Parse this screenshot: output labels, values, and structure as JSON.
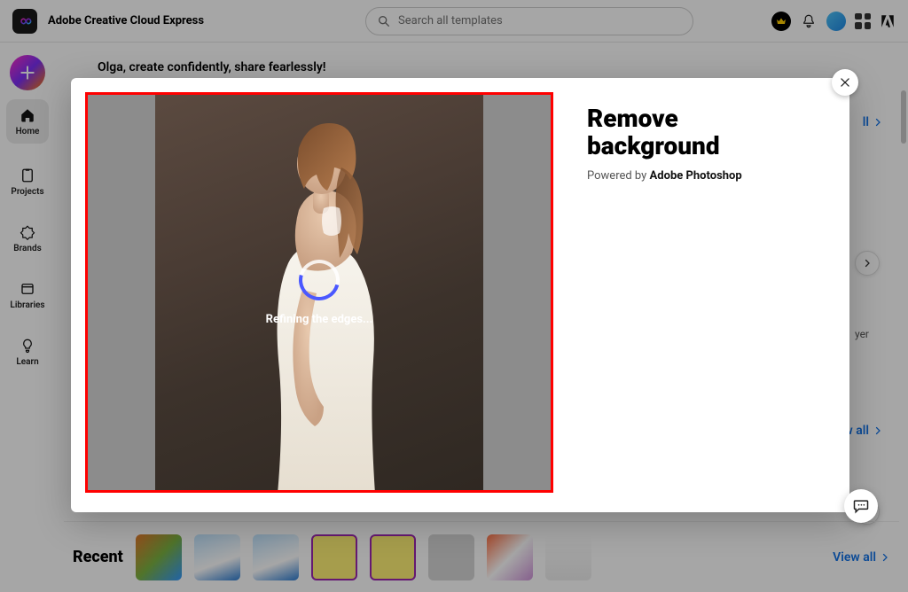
{
  "header": {
    "app_title": "Adobe Creative Cloud Express",
    "search_placeholder": "Search all templates"
  },
  "sidebar": {
    "items": [
      {
        "label": "Home"
      },
      {
        "label": "Projects"
      },
      {
        "label": "Brands"
      },
      {
        "label": "Libraries"
      },
      {
        "label": "Learn"
      }
    ]
  },
  "main": {
    "greeting": "Olga, create confidently, share fearlessly!",
    "view_all_label": "View all",
    "yer_text": "yer"
  },
  "recent": {
    "title": "Recent",
    "view_all_label": "View all"
  },
  "modal": {
    "title_line1": "Remove",
    "title_line2": "background",
    "subtitle_prefix": "Powered by ",
    "subtitle_brand": "Adobe Photoshop",
    "loading_text": "Refining the edges..."
  }
}
